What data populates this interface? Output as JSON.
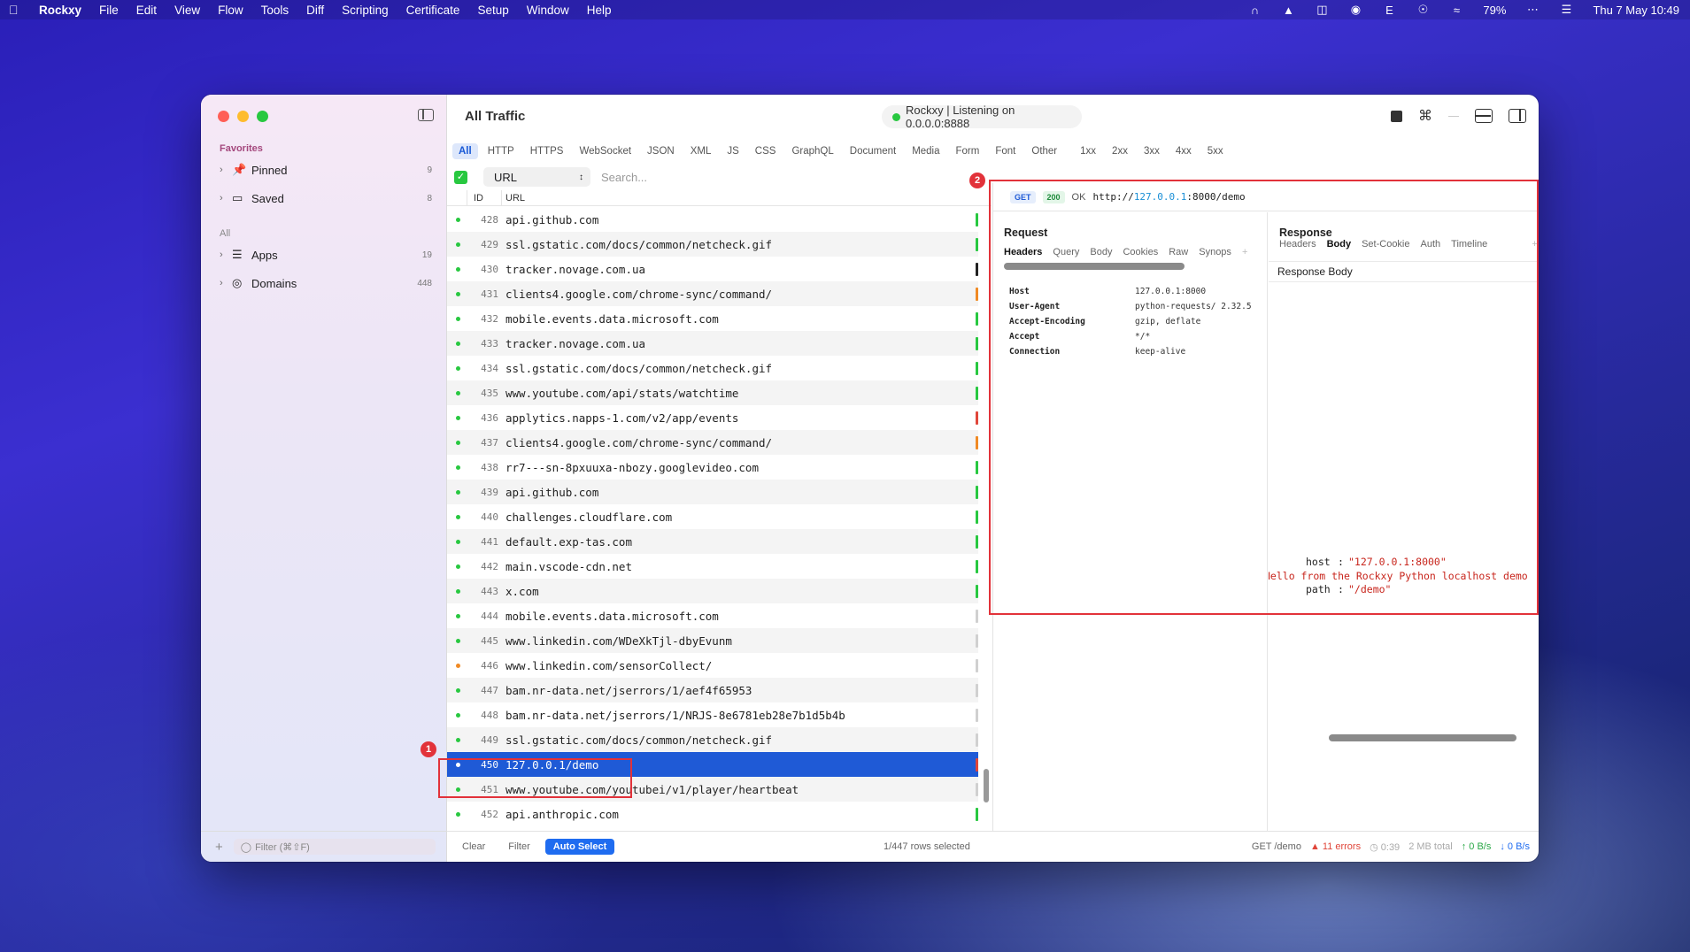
{
  "menubar": {
    "app": "Rockxy",
    "menus": [
      "File",
      "Edit",
      "View",
      "Flow",
      "Tools",
      "Diff",
      "Scripting",
      "Certificate",
      "Setup",
      "Window",
      "Help"
    ],
    "battery": "79%",
    "keyboard": "E",
    "datetime": "Thu 7 May  10:49"
  },
  "sidebar": {
    "favorites_label": "Favorites",
    "all_label": "All",
    "items": [
      {
        "label": "Pinned",
        "count": "9",
        "icon": "pin-icon"
      },
      {
        "label": "Saved",
        "count": "8",
        "icon": "tray-icon"
      },
      {
        "label": "Apps",
        "count": "19",
        "icon": "layers-icon"
      },
      {
        "label": "Domains",
        "count": "448",
        "icon": "globe-icon"
      }
    ],
    "filter_placeholder": "Filter (⌘⇧F)"
  },
  "header": {
    "title": "All Traffic",
    "status": "Rockxy | Listening on 0.0.0.0:8888"
  },
  "filters": [
    "All",
    "HTTP",
    "HTTPS",
    "WebSocket",
    "JSON",
    "XML",
    "JS",
    "CSS",
    "GraphQL",
    "Document",
    "Media",
    "Form",
    "Font",
    "Other",
    "1xx",
    "2xx",
    "3xx",
    "4xx",
    "5xx"
  ],
  "search": {
    "field": "URL",
    "placeholder": "Search..."
  },
  "list": {
    "col_id": "ID",
    "col_url": "URL",
    "rows": [
      {
        "id": "428",
        "url": "api.github.com",
        "dot": "green",
        "bar": "green"
      },
      {
        "id": "429",
        "url": "ssl.gstatic.com/docs/common/netcheck.gif",
        "dot": "green",
        "bar": "green"
      },
      {
        "id": "430",
        "url": "tracker.novage.com.ua",
        "dot": "green",
        "bar": "black"
      },
      {
        "id": "431",
        "url": "clients4.google.com/chrome-sync/command/",
        "dot": "green",
        "bar": "orange"
      },
      {
        "id": "432",
        "url": "mobile.events.data.microsoft.com",
        "dot": "green",
        "bar": "green"
      },
      {
        "id": "433",
        "url": "tracker.novage.com.ua",
        "dot": "green",
        "bar": "green"
      },
      {
        "id": "434",
        "url": "ssl.gstatic.com/docs/common/netcheck.gif",
        "dot": "green",
        "bar": "green"
      },
      {
        "id": "435",
        "url": "www.youtube.com/api/stats/watchtime",
        "dot": "green",
        "bar": "green"
      },
      {
        "id": "436",
        "url": "applytics.napps-1.com/v2/app/events",
        "dot": "green",
        "bar": "red"
      },
      {
        "id": "437",
        "url": "clients4.google.com/chrome-sync/command/",
        "dot": "green",
        "bar": "orange"
      },
      {
        "id": "438",
        "url": "rr7---sn-8pxuuxa-nbozy.googlevideo.com",
        "dot": "green",
        "bar": "green"
      },
      {
        "id": "439",
        "url": "api.github.com",
        "dot": "green",
        "bar": "green"
      },
      {
        "id": "440",
        "url": "challenges.cloudflare.com",
        "dot": "green",
        "bar": "green"
      },
      {
        "id": "441",
        "url": "default.exp-tas.com",
        "dot": "green",
        "bar": "green"
      },
      {
        "id": "442",
        "url": "main.vscode-cdn.net",
        "dot": "green",
        "bar": "green"
      },
      {
        "id": "443",
        "url": "x.com",
        "dot": "green",
        "bar": "green"
      },
      {
        "id": "444",
        "url": "mobile.events.data.microsoft.com",
        "dot": "green",
        "bar": "gray"
      },
      {
        "id": "445",
        "url": "www.linkedin.com/WDeXkTjl-dbyEvunm",
        "dot": "green",
        "bar": "gray"
      },
      {
        "id": "446",
        "url": "www.linkedin.com/sensorCollect/",
        "dot": "orange",
        "bar": "gray"
      },
      {
        "id": "447",
        "url": "bam.nr-data.net/jserrors/1/aef4f65953",
        "dot": "green",
        "bar": "gray"
      },
      {
        "id": "448",
        "url": "bam.nr-data.net/jserrors/1/NRJS-8e6781eb28e7b1d5b4b",
        "dot": "green",
        "bar": "gray"
      },
      {
        "id": "449",
        "url": "ssl.gstatic.com/docs/common/netcheck.gif",
        "dot": "green",
        "bar": "gray"
      },
      {
        "id": "450",
        "url": "127.0.0.1/demo",
        "dot": "white",
        "bar": "red",
        "selected": true
      },
      {
        "id": "451",
        "url": "www.youtube.com/youtubei/v1/player/heartbeat",
        "dot": "green",
        "bar": "gray"
      },
      {
        "id": "452",
        "url": "api.anthropic.com",
        "dot": "green",
        "bar": "green"
      }
    ]
  },
  "detail": {
    "method": "GET",
    "status_code": "200",
    "status_text": "OK",
    "url_prefix": "http://",
    "url_host": "127.0.0.1",
    "url_rest": ":8000/demo",
    "request": {
      "title": "Request",
      "tabs": [
        "Headers",
        "Query",
        "Body",
        "Cookies",
        "Raw",
        "Synops"
      ],
      "headers": [
        {
          "k": "Host",
          "v": "127.0.0.1:8000"
        },
        {
          "k": "User-Agent",
          "v": "python-requests/ 2.32.5"
        },
        {
          "k": "Accept-Encoding",
          "v": "gzip, deflate"
        },
        {
          "k": "Accept",
          "v": "*/*"
        },
        {
          "k": "Connection",
          "v": "keep-alive"
        }
      ]
    },
    "response": {
      "title": "Response",
      "tabs": [
        "Headers",
        "Body",
        "Set-Cookie",
        "Auth",
        "Timeline"
      ],
      "sub_title": "Response Body",
      "json": [
        {
          "k": "host",
          "v": "\"127.0.0.1:8000\""
        },
        {
          "k": "",
          "v": "Hello from the Rockxy Python localhost demo"
        },
        {
          "k": "path",
          "v": "\"/demo\""
        }
      ]
    }
  },
  "bottombar": {
    "clear": "Clear",
    "filter": "Filter",
    "auto_select": "Auto Select",
    "rows_selected": "1/447 rows selected",
    "current": "GET /demo",
    "errors": "11 errors",
    "time": "0:39",
    "total": "2 MB total",
    "up": "0 B/s",
    "down": "0 B/s"
  },
  "annotations": {
    "one": "1",
    "two": "2"
  }
}
